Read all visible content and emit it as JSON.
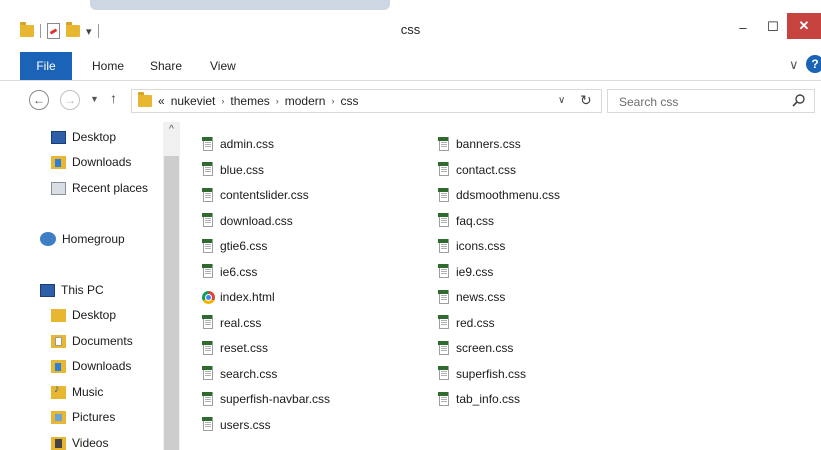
{
  "window": {
    "title": "css",
    "minimize": "–",
    "maximize": "☐",
    "close": "✕",
    "accent": "#1a63b7",
    "close_color": "#c7433f"
  },
  "quick_access": {
    "dropdown": "▾"
  },
  "ribbon": {
    "tabs": [
      "File",
      "Home",
      "Share",
      "View"
    ],
    "expand": "∨",
    "help": "?"
  },
  "nav": {
    "back": "←",
    "forward": "→",
    "recent": "▼",
    "up": "↑"
  },
  "address": {
    "overflow": "«",
    "crumbs": [
      "nukeviet",
      "themes",
      "modern",
      "css"
    ],
    "separator": "›",
    "dropdown": "∨",
    "refresh": "↻"
  },
  "search": {
    "placeholder": "Search css"
  },
  "navpane": {
    "scroll_up": "^",
    "favorites": [
      "Desktop",
      "Downloads",
      "Recent places"
    ],
    "homegroup": "Homegroup",
    "this_pc": "This PC",
    "expand": "▲",
    "pc_items": [
      "Desktop",
      "Documents",
      "Downloads",
      "Music",
      "Pictures",
      "Videos"
    ]
  },
  "files": {
    "column1": [
      {
        "name": "admin.css",
        "icon": "css-file-icon"
      },
      {
        "name": "blue.css",
        "icon": "css-file-icon"
      },
      {
        "name": "contentslider.css",
        "icon": "css-file-icon"
      },
      {
        "name": "download.css",
        "icon": "css-file-icon"
      },
      {
        "name": "gtie6.css",
        "icon": "css-file-icon"
      },
      {
        "name": "ie6.css",
        "icon": "css-file-icon"
      },
      {
        "name": "index.html",
        "icon": "chrome-icon"
      },
      {
        "name": "real.css",
        "icon": "css-file-icon"
      },
      {
        "name": "reset.css",
        "icon": "css-file-icon"
      },
      {
        "name": "search.css",
        "icon": "css-file-icon"
      },
      {
        "name": "superfish-navbar.css",
        "icon": "css-file-icon"
      },
      {
        "name": "users.css",
        "icon": "css-file-icon"
      }
    ],
    "column2": [
      {
        "name": "banners.css",
        "icon": "css-file-icon"
      },
      {
        "name": "contact.css",
        "icon": "css-file-icon"
      },
      {
        "name": "ddsmoothmenu.css",
        "icon": "css-file-icon"
      },
      {
        "name": "faq.css",
        "icon": "css-file-icon"
      },
      {
        "name": "icons.css",
        "icon": "css-file-icon"
      },
      {
        "name": "ie9.css",
        "icon": "css-file-icon"
      },
      {
        "name": "news.css",
        "icon": "css-file-icon"
      },
      {
        "name": "red.css",
        "icon": "css-file-icon"
      },
      {
        "name": "screen.css",
        "icon": "css-file-icon"
      },
      {
        "name": "superfish.css",
        "icon": "css-file-icon"
      },
      {
        "name": "tab_info.css",
        "icon": "css-file-icon"
      }
    ]
  }
}
